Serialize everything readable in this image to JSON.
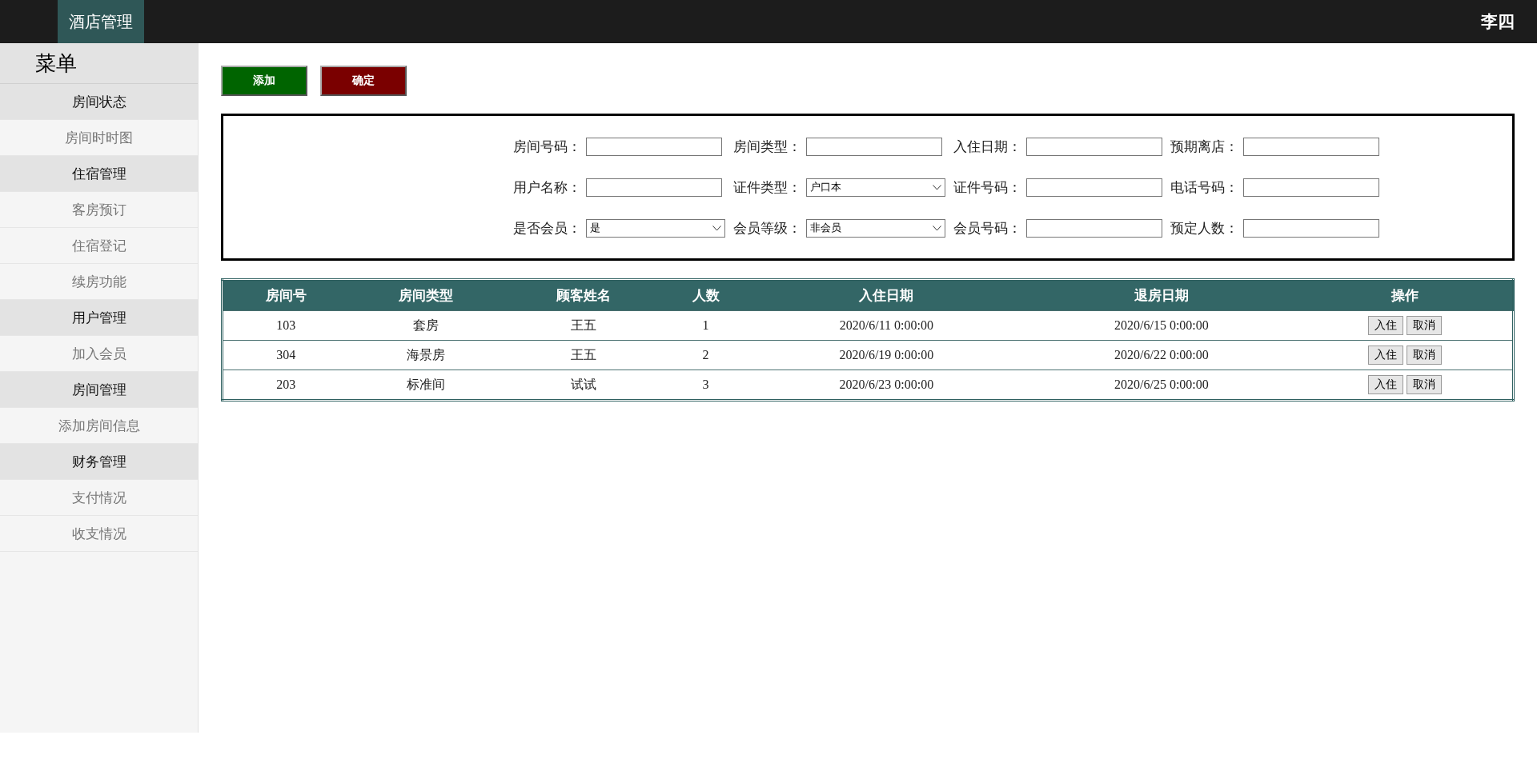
{
  "topbar": {
    "brand": "酒店管理",
    "user": "李四"
  },
  "sidebar": {
    "title": "菜单",
    "items": [
      {
        "label": "房间状态",
        "kind": "group"
      },
      {
        "label": "房间时时图",
        "kind": "link"
      },
      {
        "label": "住宿管理",
        "kind": "group"
      },
      {
        "label": "客房预订",
        "kind": "link"
      },
      {
        "label": "住宿登记",
        "kind": "link"
      },
      {
        "label": "续房功能",
        "kind": "link"
      },
      {
        "label": "用户管理",
        "kind": "group"
      },
      {
        "label": "加入会员",
        "kind": "link"
      },
      {
        "label": "房间管理",
        "kind": "group"
      },
      {
        "label": "添加房间信息",
        "kind": "link"
      },
      {
        "label": "财务管理",
        "kind": "group"
      },
      {
        "label": "支付情况",
        "kind": "link"
      },
      {
        "label": "收支情况",
        "kind": "link"
      }
    ]
  },
  "actions": [
    {
      "label": "添加",
      "kind": "add"
    },
    {
      "label": "确定",
      "kind": "confirm"
    }
  ],
  "form": {
    "fields": [
      {
        "label": "房间号码：",
        "kind": "input"
      },
      {
        "label": "房间类型：",
        "kind": "input"
      },
      {
        "label": "入住日期：",
        "kind": "input"
      },
      {
        "label": "预期离店：",
        "kind": "input"
      },
      {
        "label": "用户名称：",
        "kind": "input"
      },
      {
        "label": "证件类型：",
        "kind": "select",
        "value": "户口本"
      },
      {
        "label": "证件号码：",
        "kind": "input"
      },
      {
        "label": "电话号码：",
        "kind": "input"
      },
      {
        "label": "是否会员：",
        "kind": "select",
        "value": "是"
      },
      {
        "label": "会员等级：",
        "kind": "select",
        "value": "非会员"
      },
      {
        "label": "会员号码：",
        "kind": "input"
      },
      {
        "label": "预定人数：",
        "kind": "input"
      }
    ]
  },
  "table": {
    "columns": [
      "房间号",
      "房间类型",
      "顾客姓名",
      "人数",
      "入住日期",
      "退房日期",
      "操作"
    ],
    "rows": [
      {
        "cells": [
          "103",
          "套房",
          "王五",
          "1",
          "2020/6/11 0:00:00",
          "2020/6/15 0:00:00"
        ],
        "buttons": [
          "入住",
          "取消"
        ]
      },
      {
        "cells": [
          "304",
          "海景房",
          "王五",
          "2",
          "2020/6/19 0:00:00",
          "2020/6/22 0:00:00"
        ],
        "buttons": [
          "入住",
          "取消"
        ]
      },
      {
        "cells": [
          "203",
          "标准间",
          "试试",
          "3",
          "2020/6/23 0:00:00",
          "2020/6/25 0:00:00"
        ],
        "buttons": [
          "入住",
          "取消"
        ]
      }
    ]
  }
}
